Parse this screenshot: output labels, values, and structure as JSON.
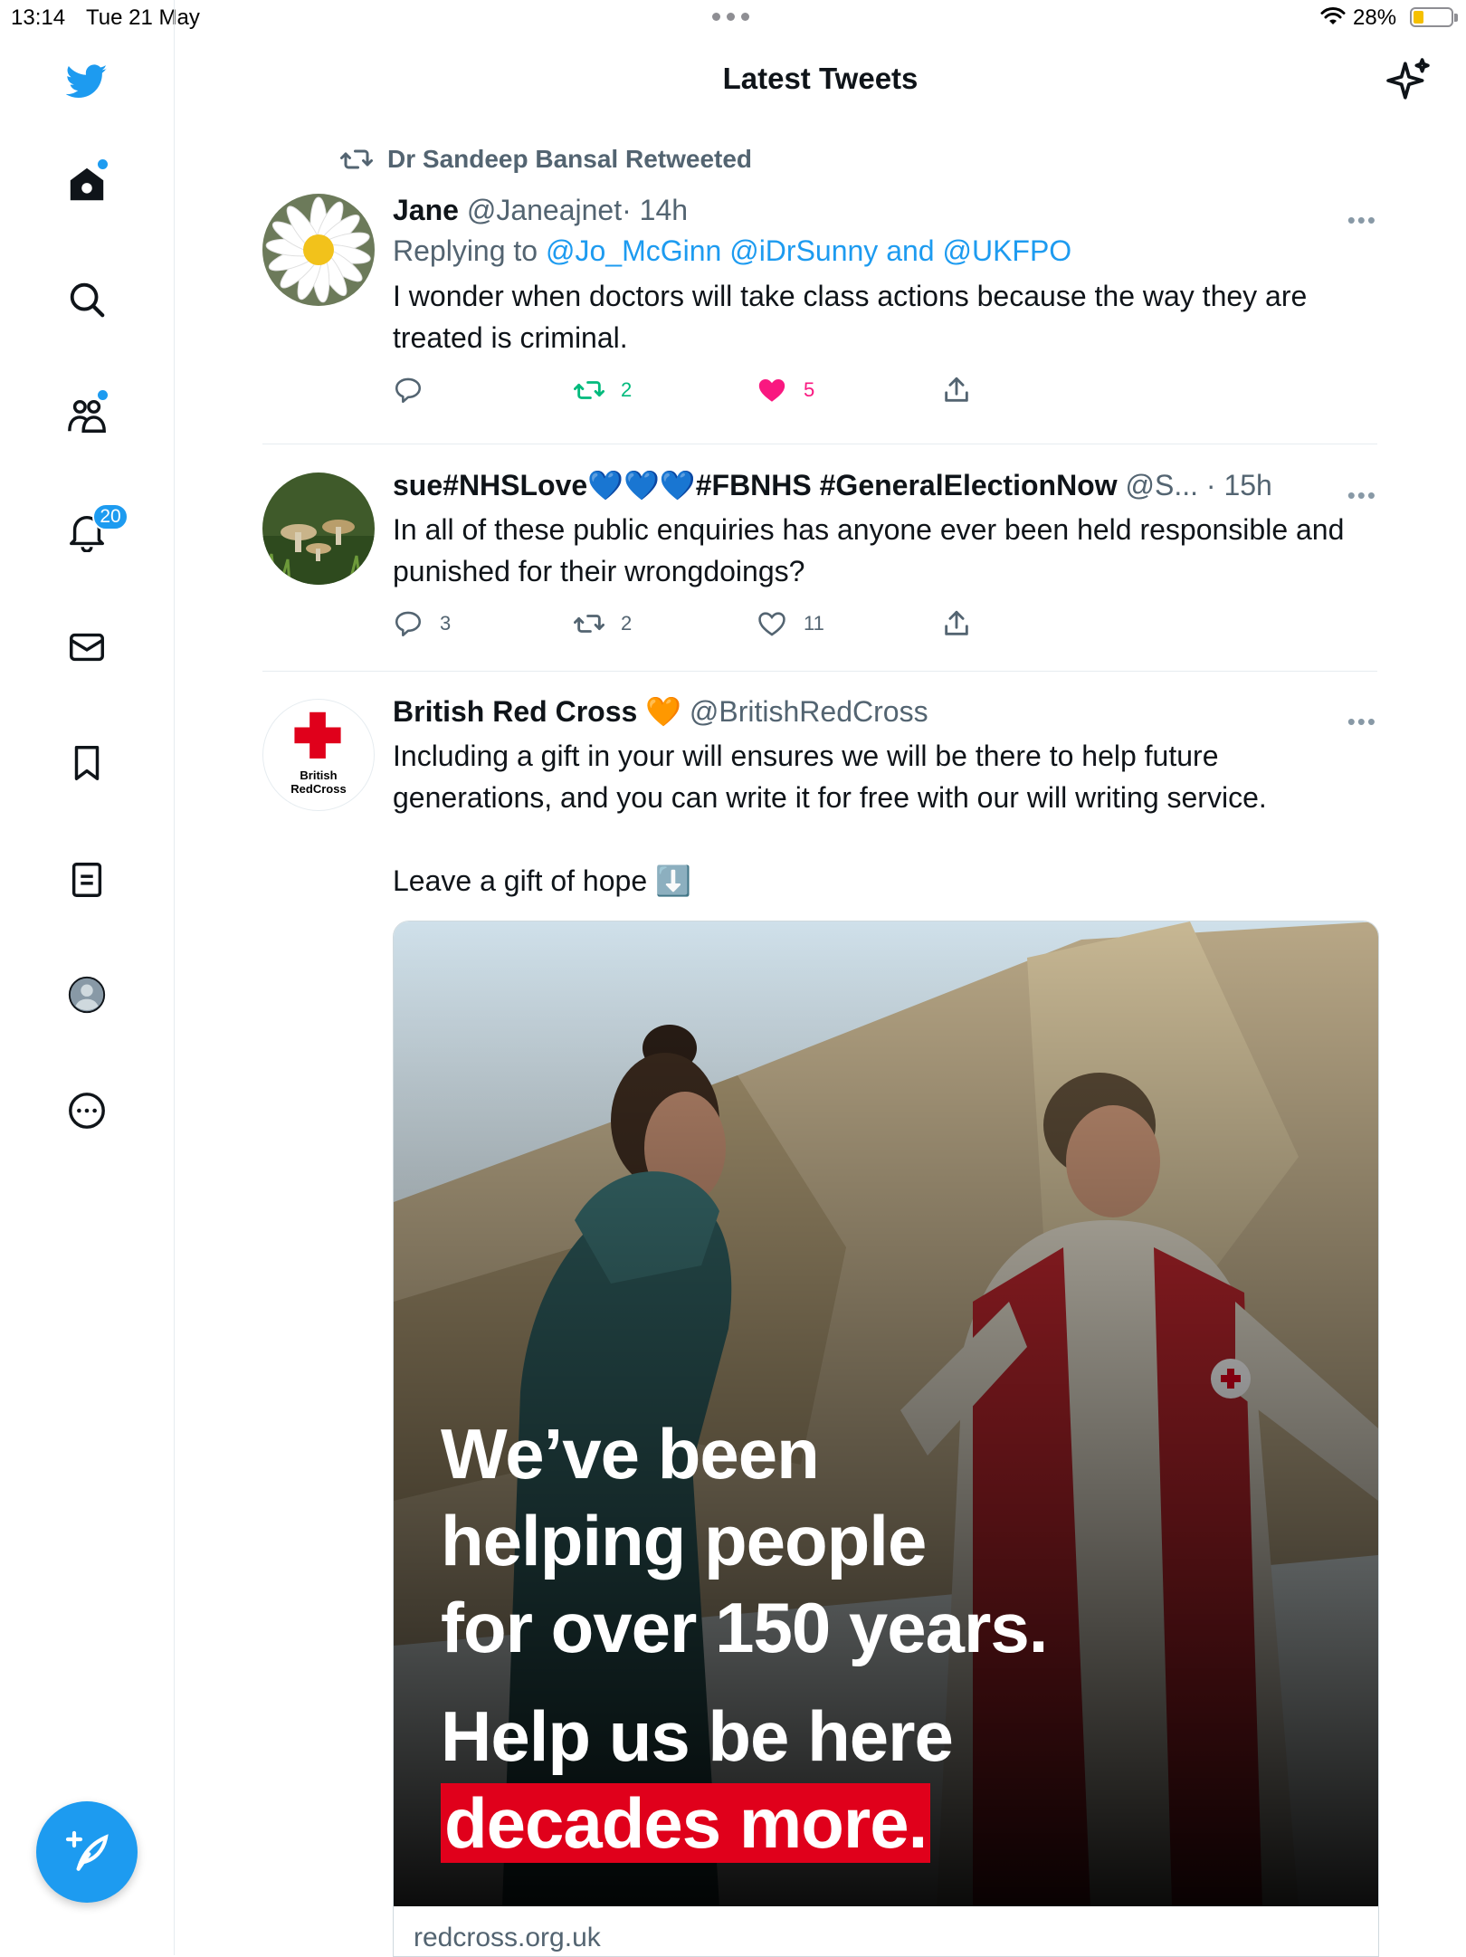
{
  "status_bar": {
    "time": "13:14",
    "date": "Tue 21 May",
    "battery": "28%",
    "battery_level": 0.28
  },
  "header": {
    "title": "Latest Tweets",
    "sparkle_icon": "sparkle-icon"
  },
  "sidebar": {
    "items": [
      {
        "name": "home",
        "icon": "home-icon",
        "dot": true
      },
      {
        "name": "explore",
        "icon": "search-icon",
        "dot": false
      },
      {
        "name": "communities",
        "icon": "people-icon",
        "dot": true
      },
      {
        "name": "notifications",
        "icon": "bell-icon",
        "badge": "20"
      },
      {
        "name": "messages",
        "icon": "mail-icon"
      },
      {
        "name": "bookmarks",
        "icon": "bookmark-icon"
      },
      {
        "name": "lists",
        "icon": "list-icon"
      },
      {
        "name": "profile",
        "icon": "avatar-icon"
      },
      {
        "name": "more",
        "icon": "more-circle-icon"
      }
    ],
    "compose_icon": "compose-icon"
  },
  "tweets": [
    {
      "retweeted_by": "Dr Sandeep Bansal Retweeted",
      "name": "Jane",
      "handle": "@Janeajnet",
      "time": "· 14h",
      "replying_prefix": "Replying to",
      "replying_to": "@Jo_McGinn @iDrSunny",
      "replying_and": "and",
      "replying_last": "@UKFPO",
      "text": "I wonder when doctors will take class actions because the way they are treated is criminal.",
      "replies": "",
      "retweets": "2",
      "likes": "5",
      "liked": true,
      "retweeted": true
    },
    {
      "name": "sue#NHSLove💙💙💙#FBNHS #GeneralElectionNow",
      "handle": "@S...",
      "time": "· 15h",
      "text": "In all of these public enquiries has anyone ever been held responsible and punished for their wrongdoings?",
      "replies": "3",
      "retweets": "2",
      "likes": "11"
    },
    {
      "name": "British Red Cross",
      "name_emoji": "🧡",
      "handle": "@BritishRedCross",
      "text": "Including a gift in your will ensures we will be there to help future generations, and you can write it for free with our will writing service.\n\nLeave a gift of hope ⬇️",
      "avatar_text_1": "British",
      "avatar_text_2": "RedCross",
      "card": {
        "line1": "We’ve been",
        "line2": "helping people",
        "line3": "for over 150 years.",
        "line4": "Help us be here",
        "line5": "decades more.",
        "url": "redcross.org.uk"
      }
    }
  ],
  "colors": {
    "accent": "#1d9bf0",
    "like": "#f91880",
    "retweet": "#00ba7c",
    "redcross": "#e0001b"
  }
}
